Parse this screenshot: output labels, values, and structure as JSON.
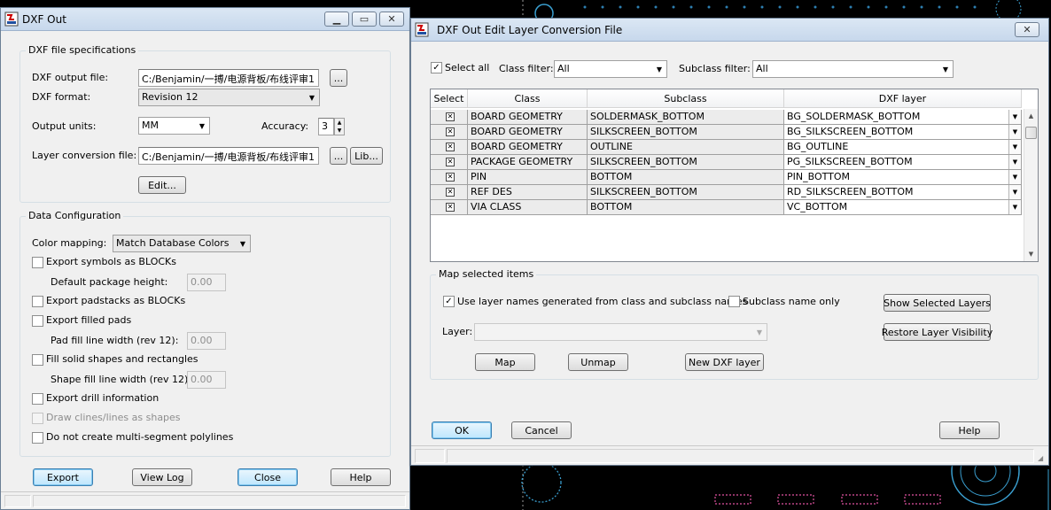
{
  "left_window": {
    "title": "DXF Out",
    "file_spec": {
      "group_label": "DXF file specifications",
      "output_file_label": "DXF output file:",
      "output_file_value": "C:/Benjamin/一搏/电源背板/布线评审1",
      "browse_label": "...",
      "format_label": "DXF format:",
      "format_value": "Revision 12",
      "units_label": "Output units:",
      "units_value": "MM",
      "accuracy_label": "Accuracy:",
      "accuracy_value": "3",
      "conv_file_label": "Layer conversion file:",
      "conv_file_value": "C:/Benjamin/一搏/电源背板/布线评审1",
      "lib_label": "Lib...",
      "edit_label": "Edit..."
    },
    "data_config": {
      "group_label": "Data Configuration",
      "color_mapping_label": "Color mapping:",
      "color_mapping_value": "Match Database Colors",
      "export_symbols": "Export symbols as BLOCKs",
      "default_pkg_height_label": "Default package height:",
      "default_pkg_height_value": "0.00",
      "export_padstacks": "Export padstacks as BLOCKs",
      "export_filled_pads": "Export filled pads",
      "pad_fill_label": "Pad fill line width (rev 12):",
      "pad_fill_value": "0.00",
      "fill_solid": "Fill solid shapes and rectangles",
      "shape_fill_label": "Shape fill line width (rev 12):",
      "shape_fill_value": "0.00",
      "export_drill": "Export drill information",
      "draw_clines": "Draw clines/lines as shapes",
      "no_multi_segment": "Do not create multi-segment polylines"
    },
    "buttons": {
      "export": "Export",
      "view_log": "View Log",
      "close": "Close",
      "help": "Help"
    }
  },
  "right_window": {
    "title": "DXF Out Edit Layer Conversion File",
    "select_all_label": "Select all",
    "class_filter_label": "Class filter:",
    "class_filter_value": "All",
    "subclass_filter_label": "Subclass filter:",
    "subclass_filter_value": "All",
    "table": {
      "headers": [
        "Select",
        "Class",
        "Subclass",
        "DXF layer"
      ],
      "rows": [
        {
          "class": "BOARD GEOMETRY",
          "subclass": "SOLDERMASK_BOTTOM",
          "dxf_layer": "BG_SOLDERMASK_BOTTOM",
          "selected": true
        },
        {
          "class": "BOARD GEOMETRY",
          "subclass": "SILKSCREEN_BOTTOM",
          "dxf_layer": "BG_SILKSCREEN_BOTTOM",
          "selected": true
        },
        {
          "class": "BOARD GEOMETRY",
          "subclass": "OUTLINE",
          "dxf_layer": "BG_OUTLINE",
          "selected": true
        },
        {
          "class": "PACKAGE GEOMETRY",
          "subclass": "SILKSCREEN_BOTTOM",
          "dxf_layer": "PG_SILKSCREEN_BOTTOM",
          "selected": true
        },
        {
          "class": "PIN",
          "subclass": "BOTTOM",
          "dxf_layer": "PIN_BOTTOM",
          "selected": true
        },
        {
          "class": "REF DES",
          "subclass": "SILKSCREEN_BOTTOM",
          "dxf_layer": "RD_SILKSCREEN_BOTTOM",
          "selected": true
        },
        {
          "class": "VIA CLASS",
          "subclass": "BOTTOM",
          "dxf_layer": "VC_BOTTOM",
          "selected": true
        }
      ]
    },
    "map_group": {
      "group_label": "Map selected items",
      "use_layer_names": "Use layer names generated from class and subclass names",
      "subclass_only": "Subclass name only",
      "show_selected": "Show Selected Layers",
      "restore_visibility": "Restore Layer Visibility",
      "layer_label": "Layer:",
      "layer_value": "",
      "map": "Map",
      "unmap": "Unmap",
      "new_layer": "New DXF layer"
    },
    "buttons": {
      "ok": "OK",
      "cancel": "Cancel",
      "help": "Help"
    }
  },
  "colors": {
    "cad_cyan": "#3a9fd0",
    "cad_magenta": "#e0529f"
  }
}
